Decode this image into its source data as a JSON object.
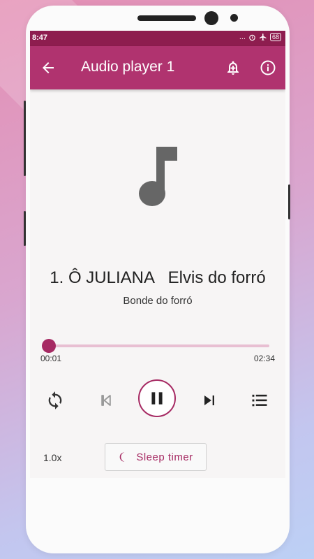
{
  "status_bar": {
    "time": "8:47",
    "dots": "...",
    "battery": "68"
  },
  "app_bar": {
    "title": "Audio player 1",
    "back_icon": "arrow-back-icon",
    "bell_icon": "add-alert-icon",
    "info_icon": "info-icon"
  },
  "player": {
    "artwork_icon": "music-note-icon",
    "song_title": "1. Ô JULIANA   Elvis do forró",
    "album": "Bonde do forró",
    "current_time": "00:01",
    "total_time": "02:34",
    "progress": 0.006,
    "state": "playing"
  },
  "controls": {
    "repeat_icon": "repeat-icon",
    "previous_icon": "skip-previous-icon",
    "play_pause_icon": "pause-icon",
    "next_icon": "skip-next-icon",
    "queue_icon": "queue-list-icon"
  },
  "footer": {
    "speed": "1.0x",
    "sleep_timer_label": "Sleep timer",
    "sleep_icon": "moon-icon"
  },
  "colors": {
    "primary": "#b0336f",
    "primary_dark": "#8e1d4f",
    "accent": "#a62a63",
    "track": "#e8bfd2"
  }
}
